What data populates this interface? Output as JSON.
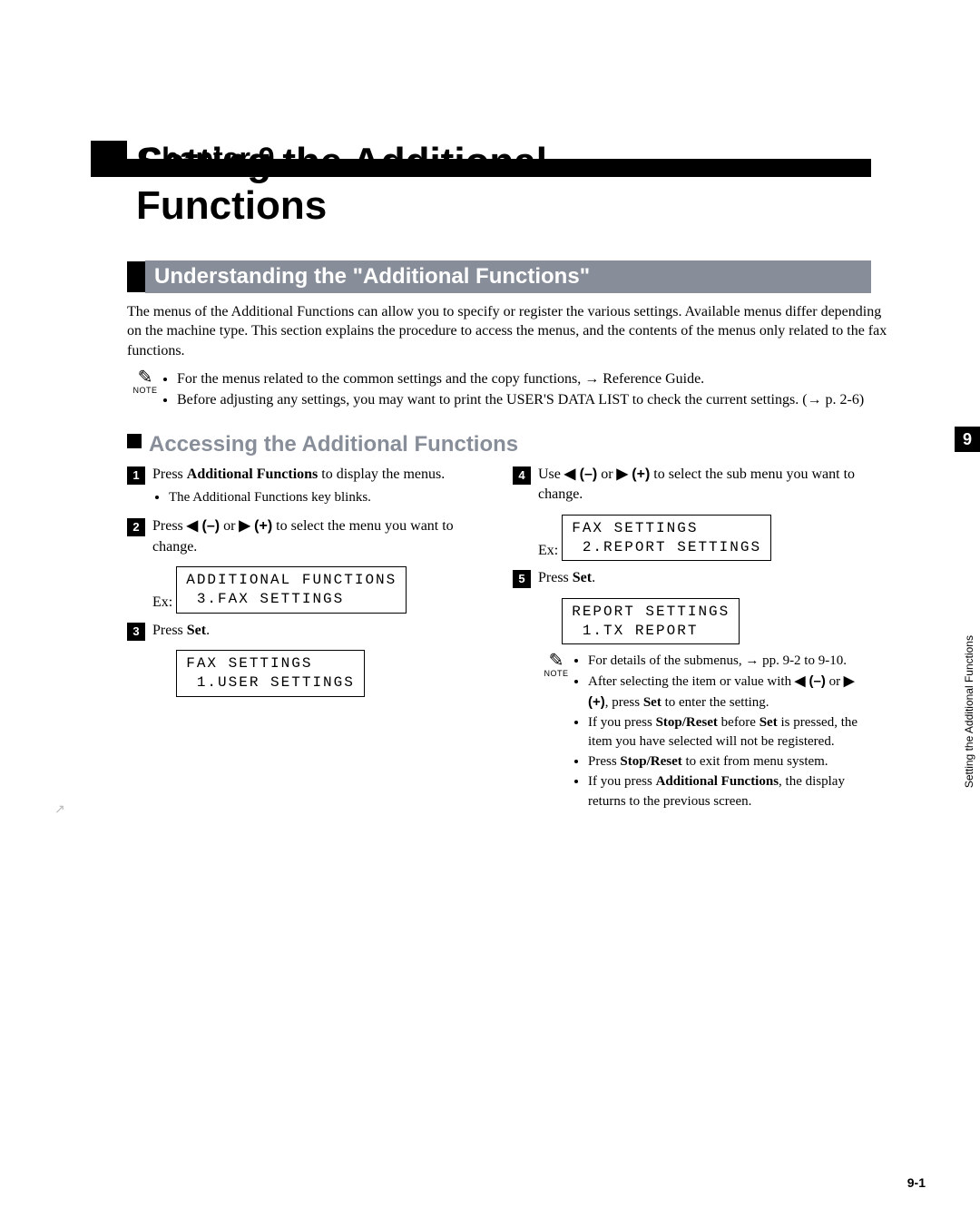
{
  "chapter": {
    "label": "Chapter 9",
    "title_l1": "Setting the Additional",
    "title_l2": "Functions"
  },
  "section": {
    "title": "Understanding the \"Additional Functions\""
  },
  "intro_para": "The menus of the Additional Functions can allow you to specify or register the various settings. Available menus differ depending on the machine type. This section explains the procedure to access the menus, and the contents of the menus only related to the fax functions.",
  "note_label": "NOTE",
  "top_note_items": [
    "For the menus related to the common settings and the copy functions, → Reference Guide.",
    "Before adjusting any settings, you may want to print the USER'S DATA LIST to check the current settings. (→ p. 2-6)"
  ],
  "subhead": "Accessing the Additional Functions",
  "steps": {
    "s1_a": "Press ",
    "s1_b": "Additional Functions",
    "s1_c": " to display the menus.",
    "s1_bullet": "The Additional Functions key blinks.",
    "s2_a": "Press ",
    "s2_b": "◀ (–)",
    "s2_c": " or ",
    "s2_d": "▶ (+)",
    "s2_e": " to select the menu you want to change.",
    "ex_label": "Ex:",
    "lcd2_l1": "ADDITIONAL FUNCTIONS",
    "lcd2_l2": " 3.FAX SETTINGS",
    "s3_a": "Press ",
    "s3_b": "Set",
    "s3_c": ".",
    "lcd3_l1": "FAX SETTINGS",
    "lcd3_l2": " 1.USER SETTINGS",
    "s4_a": "Use ",
    "s4_b": "◀ (–)",
    "s4_c": " or ",
    "s4_d": "▶ (+)",
    "s4_e": " to select the sub menu you want to change.",
    "lcd4_l1": "FAX SETTINGS",
    "lcd4_l2": " 2.REPORT SETTINGS",
    "s5_a": "Press ",
    "s5_b": "Set",
    "s5_c": ".",
    "lcd5_l1": "REPORT SETTINGS",
    "lcd5_l2": " 1.TX REPORT"
  },
  "right_notes": {
    "n1": "For details of the submenus, → pp. 9-2 to 9-10.",
    "n2_a": "After selecting the item or value with ",
    "n2_b": "◀ (–)",
    "n2_c": " or ",
    "n2_d": "▶ (+)",
    "n2_e": ", press ",
    "n2_f": "Set",
    "n2_g": " to enter the setting.",
    "n3_a": "If you press ",
    "n3_b": "Stop/Reset",
    "n3_c": " before ",
    "n3_d": "Set",
    "n3_e": " is pressed, the item you have selected will not be registered.",
    "n4_a": "Press ",
    "n4_b": "Stop/Reset",
    "n4_c": " to exit from menu system.",
    "n5_a": "If you press ",
    "n5_b": "Additional Functions",
    "n5_c": ", the display returns to the previous screen."
  },
  "ghost_play": "↗",
  "side_tab": "9",
  "side_text": "Setting the Additional Functions",
  "page_num": "9-1"
}
